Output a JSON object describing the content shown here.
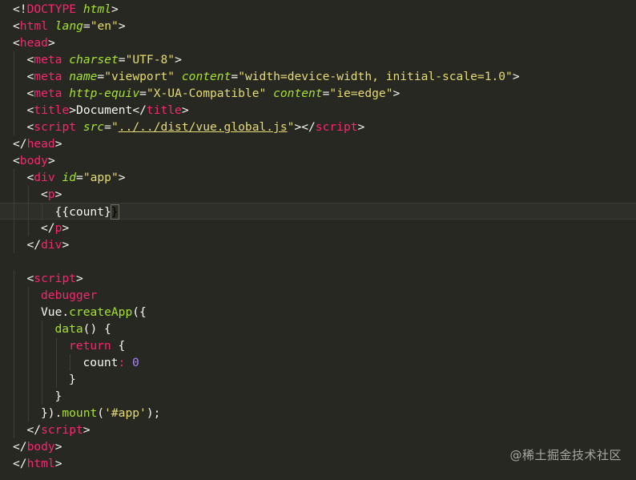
{
  "editor": {
    "lines": [
      {
        "indent": 0,
        "tokens": [
          [
            "punc",
            "<!"
          ],
          [
            "tag",
            "DOCTYPE"
          ],
          [
            "punc",
            " "
          ],
          [
            "attr",
            "html"
          ],
          [
            "punc",
            ">"
          ]
        ]
      },
      {
        "indent": 0,
        "tokens": [
          [
            "punc",
            "<"
          ],
          [
            "tag",
            "html"
          ],
          [
            "punc",
            " "
          ],
          [
            "attr",
            "lang"
          ],
          [
            "punc",
            "="
          ],
          [
            "str",
            "\"en\""
          ],
          [
            "punc",
            ">"
          ]
        ]
      },
      {
        "indent": 0,
        "tokens": [
          [
            "punc",
            "<"
          ],
          [
            "tag",
            "head"
          ],
          [
            "punc",
            ">"
          ]
        ]
      },
      {
        "indent": 1,
        "tokens": [
          [
            "punc",
            "<"
          ],
          [
            "tag",
            "meta"
          ],
          [
            "punc",
            " "
          ],
          [
            "attr",
            "charset"
          ],
          [
            "punc",
            "="
          ],
          [
            "str",
            "\"UTF-8\""
          ],
          [
            "punc",
            ">"
          ]
        ]
      },
      {
        "indent": 1,
        "tokens": [
          [
            "punc",
            "<"
          ],
          [
            "tag",
            "meta"
          ],
          [
            "punc",
            " "
          ],
          [
            "attr",
            "name"
          ],
          [
            "punc",
            "="
          ],
          [
            "str",
            "\"viewport\""
          ],
          [
            "punc",
            " "
          ],
          [
            "attr",
            "content"
          ],
          [
            "punc",
            "="
          ],
          [
            "str",
            "\"width=device-width, initial-scale=1.0\""
          ],
          [
            "punc",
            ">"
          ]
        ]
      },
      {
        "indent": 1,
        "tokens": [
          [
            "punc",
            "<"
          ],
          [
            "tag",
            "meta"
          ],
          [
            "punc",
            " "
          ],
          [
            "attr",
            "http-equiv"
          ],
          [
            "punc",
            "="
          ],
          [
            "str",
            "\"X-UA-Compatible\""
          ],
          [
            "punc",
            " "
          ],
          [
            "attr",
            "content"
          ],
          [
            "punc",
            "="
          ],
          [
            "str",
            "\"ie=edge\""
          ],
          [
            "punc",
            ">"
          ]
        ]
      },
      {
        "indent": 1,
        "tokens": [
          [
            "punc",
            "<"
          ],
          [
            "tag",
            "title"
          ],
          [
            "punc",
            ">"
          ],
          [
            "text",
            "Document"
          ],
          [
            "punc",
            "</"
          ],
          [
            "tag",
            "title"
          ],
          [
            "punc",
            ">"
          ]
        ]
      },
      {
        "indent": 1,
        "tokens": [
          [
            "punc",
            "<"
          ],
          [
            "tag",
            "script"
          ],
          [
            "punc",
            " "
          ],
          [
            "attr",
            "src"
          ],
          [
            "punc",
            "="
          ],
          [
            "str",
            "\""
          ],
          [
            "link",
            "../../dist/vue.global.js"
          ],
          [
            "str",
            "\""
          ],
          [
            "punc",
            "></"
          ],
          [
            "tag",
            "script"
          ],
          [
            "punc",
            ">"
          ]
        ]
      },
      {
        "indent": 0,
        "tokens": [
          [
            "punc",
            "</"
          ],
          [
            "tag",
            "head"
          ],
          [
            "punc",
            ">"
          ]
        ]
      },
      {
        "indent": 0,
        "tokens": [
          [
            "punc",
            "<"
          ],
          [
            "tag",
            "body"
          ],
          [
            "punc",
            ">"
          ]
        ]
      },
      {
        "indent": 1,
        "tokens": [
          [
            "punc",
            "<"
          ],
          [
            "tag",
            "div"
          ],
          [
            "punc",
            " "
          ],
          [
            "attr",
            "id"
          ],
          [
            "punc",
            "="
          ],
          [
            "str",
            "\"app\""
          ],
          [
            "punc",
            ">"
          ]
        ]
      },
      {
        "indent": 2,
        "tokens": [
          [
            "punc",
            "<"
          ],
          [
            "tag",
            "p"
          ],
          [
            "punc",
            ">"
          ]
        ]
      },
      {
        "indent": 3,
        "active": true,
        "tokens": [
          [
            "text",
            "{{count}"
          ],
          [
            "cursor",
            "}"
          ]
        ]
      },
      {
        "indent": 2,
        "tokens": [
          [
            "punc",
            "</"
          ],
          [
            "tag",
            "p"
          ],
          [
            "punc",
            ">"
          ]
        ]
      },
      {
        "indent": 1,
        "tokens": [
          [
            "punc",
            "</"
          ],
          [
            "tag",
            "div"
          ],
          [
            "punc",
            ">"
          ]
        ]
      },
      {
        "indent": 0,
        "tokens": []
      },
      {
        "indent": 1,
        "tokens": [
          [
            "punc",
            "<"
          ],
          [
            "tag",
            "script"
          ],
          [
            "punc",
            ">"
          ]
        ]
      },
      {
        "indent": 2,
        "tokens": [
          [
            "key",
            "debugger"
          ]
        ]
      },
      {
        "indent": 2,
        "tokens": [
          [
            "text",
            "Vue."
          ],
          [
            "fn",
            "createApp"
          ],
          [
            "text",
            "({"
          ]
        ]
      },
      {
        "indent": 3,
        "tokens": [
          [
            "fn",
            "data"
          ],
          [
            "text",
            "() {"
          ]
        ]
      },
      {
        "indent": 4,
        "tokens": [
          [
            "key",
            "return"
          ],
          [
            "text",
            " {"
          ]
        ]
      },
      {
        "indent": 5,
        "tokens": [
          [
            "text",
            "count"
          ],
          [
            "key",
            ":"
          ],
          [
            "text",
            " "
          ],
          [
            "num",
            "0"
          ]
        ]
      },
      {
        "indent": 4,
        "tokens": [
          [
            "text",
            "}"
          ]
        ]
      },
      {
        "indent": 3,
        "tokens": [
          [
            "text",
            "}"
          ]
        ]
      },
      {
        "indent": 2,
        "tokens": [
          [
            "text",
            "})."
          ],
          [
            "fn",
            "mount"
          ],
          [
            "text",
            "("
          ],
          [
            "str",
            "'#app'"
          ],
          [
            "text",
            ");"
          ]
        ]
      },
      {
        "indent": 1,
        "tokens": [
          [
            "punc",
            "</"
          ],
          [
            "tag",
            "script"
          ],
          [
            "punc",
            ">"
          ]
        ]
      },
      {
        "indent": 0,
        "tokens": [
          [
            "punc",
            "</"
          ],
          [
            "tag",
            "body"
          ],
          [
            "punc",
            ">"
          ]
        ]
      },
      {
        "indent": 0,
        "tokens": [
          [
            "punc",
            "</"
          ],
          [
            "tag",
            "html"
          ],
          [
            "punc",
            ">"
          ]
        ]
      }
    ]
  },
  "watermark": "@稀土掘金技术社区",
  "colors": {
    "background": "#272822",
    "tag": "#f92672",
    "attribute": "#a6e22e",
    "string": "#e6db74",
    "number": "#ae81ff",
    "text": "#f8f8f2"
  }
}
